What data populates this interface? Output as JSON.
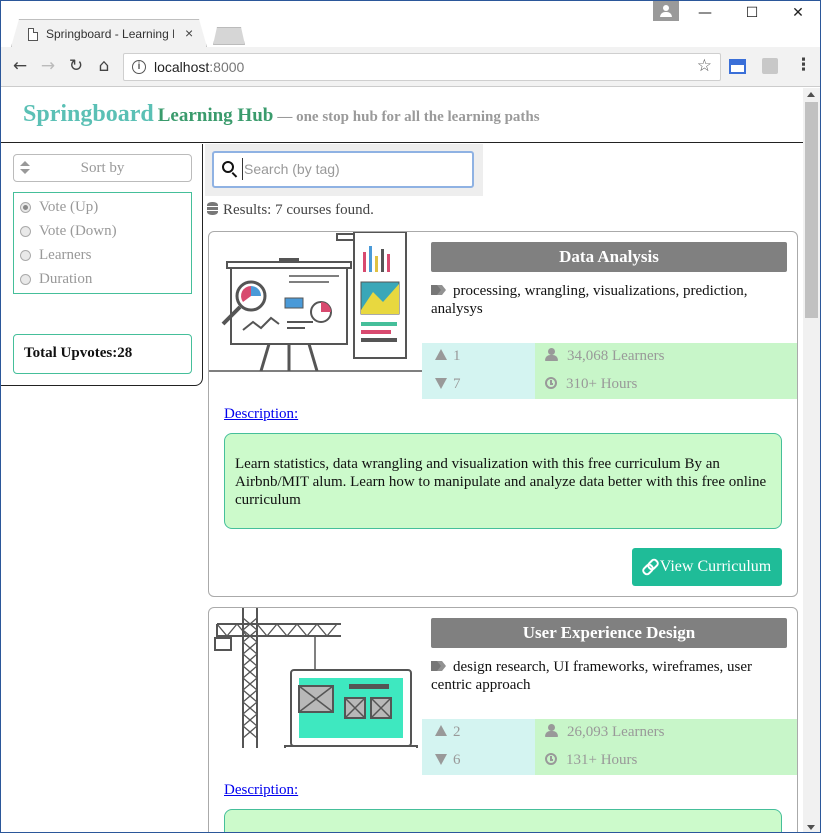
{
  "browser": {
    "tab_title": "Springboard - Learning H",
    "tab_close": "×",
    "url_host": "localhost",
    "url_port": ":8000",
    "min_glyph": "—",
    "max_glyph": "☐",
    "close_glyph": "✕"
  },
  "header": {
    "brand_name": "Springboard",
    "brand_hub": "Learning Hub",
    "tagline": "— one stop hub for all the learning paths"
  },
  "sidebar": {
    "sort_label": "Sort by",
    "options": [
      {
        "label": "Vote (Up)",
        "selected": true
      },
      {
        "label": "Vote (Down)",
        "selected": false
      },
      {
        "label": "Learners",
        "selected": false
      },
      {
        "label": "Duration",
        "selected": false
      }
    ],
    "total_upvotes": "Total Upvotes:28"
  },
  "search": {
    "placeholder": "Search (by tag)",
    "value": ""
  },
  "results_text": "Results: 7 courses found.",
  "courses": [
    {
      "title": "Data Analysis",
      "tags": "processing, wrangling, visualizations, prediction, analysys",
      "upvotes": "1",
      "downvotes": "7",
      "learners": "34,068 Learners",
      "hours": "310+ Hours",
      "description_link": "Description:",
      "description": "Learn statistics, data wrangling and visualization with this free curriculum By an Airbnb/MIT alum. Learn how to manipulate and analyze data better with this free online curriculum",
      "button_label": "View Curriculum"
    },
    {
      "title": "User Experience Design",
      "tags": "design research, UI frameworks, wireframes, user centric approach",
      "upvotes": "2",
      "downvotes": "6",
      "learners": "26,093 Learners",
      "hours": "131+ Hours",
      "description_link": "Description:"
    }
  ],
  "colors": {
    "brand": "#5bc0b5",
    "hub": "#3a9b6c",
    "accent_button": "#1fbc98",
    "title_bar": "#808080",
    "votes_bg": "#d4f4f1",
    "meta_bg": "#c8f6c9",
    "desc_bg": "#ccfacb",
    "border_green": "#45bf9a"
  }
}
